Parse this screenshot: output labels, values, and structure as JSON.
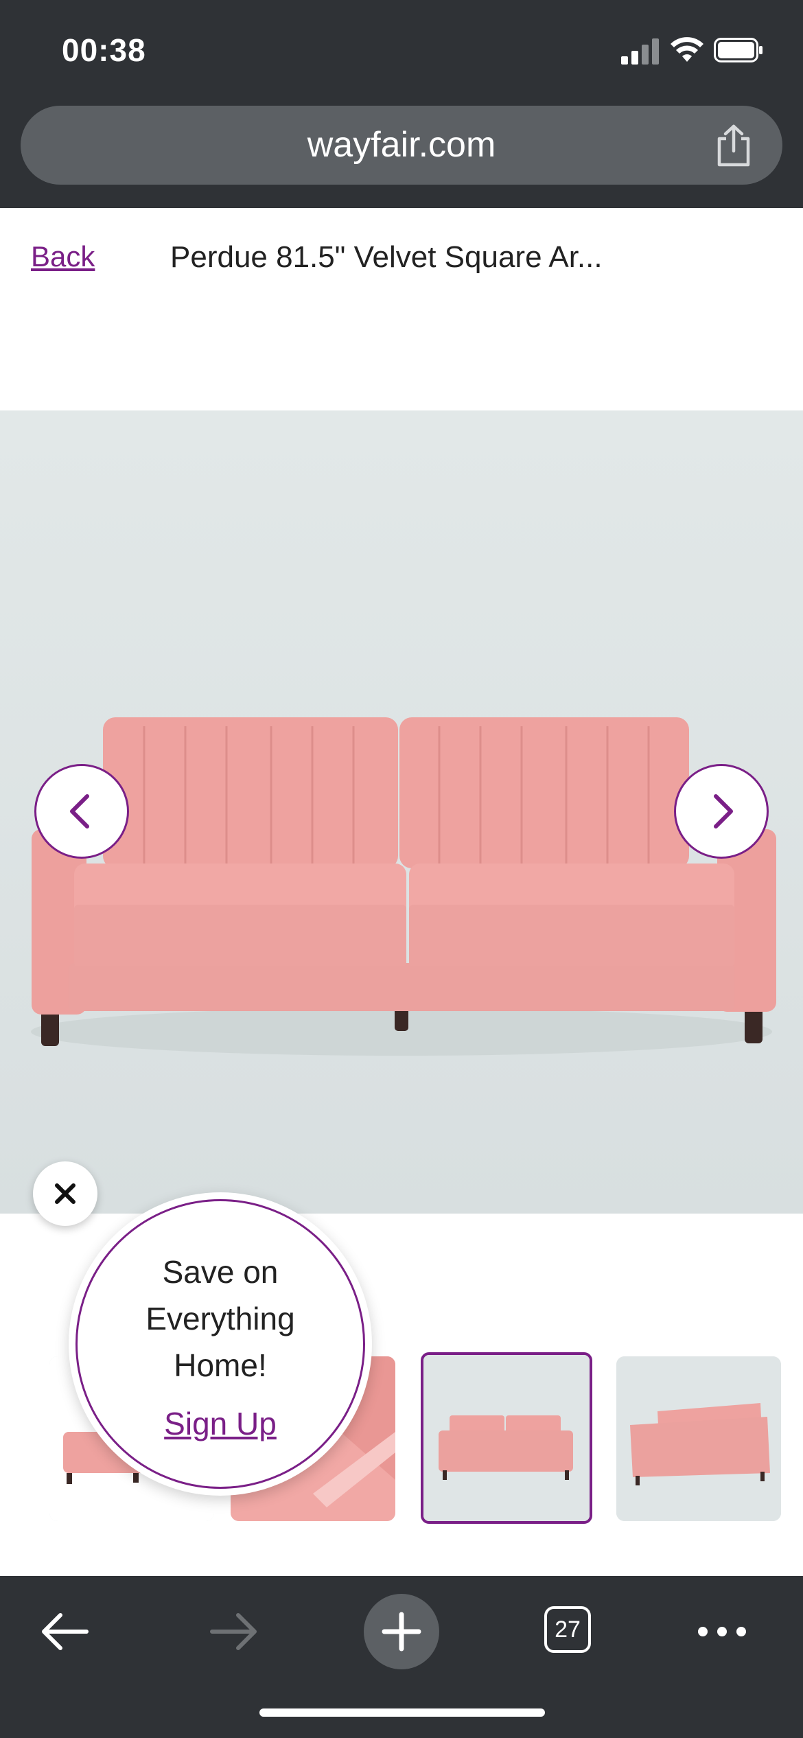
{
  "status_bar": {
    "time": "00:38"
  },
  "browser": {
    "url": "wayfair.com",
    "open_tabs": "27"
  },
  "header": {
    "back_label": "Back",
    "product_title": "Perdue 81.5\" Velvet Square Ar..."
  },
  "promo": {
    "line1": "Save on",
    "line2": "Everything",
    "line3": "Home!",
    "cta": "Sign Up"
  },
  "colors": {
    "accent": "#7a1f87",
    "sofa": "#eea29f",
    "chrome": "#2f3236"
  },
  "icons": [
    "signal-icon",
    "wifi-icon",
    "battery-icon",
    "share-icon",
    "chevron-left-icon",
    "chevron-right-icon",
    "close-icon",
    "arrow-left-icon",
    "arrow-right-icon",
    "plus-icon",
    "tabs-icon",
    "more-icon"
  ]
}
